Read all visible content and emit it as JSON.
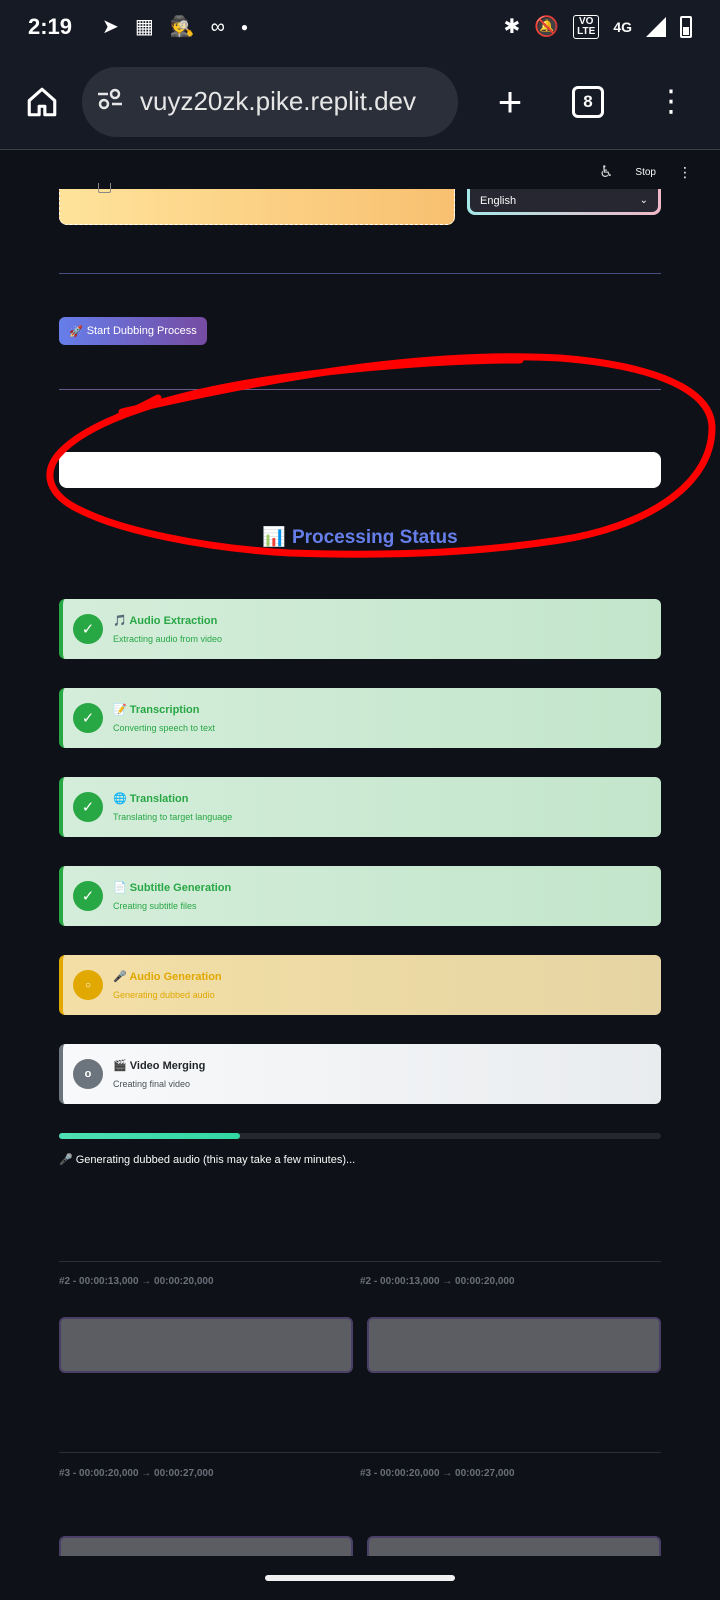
{
  "status_bar": {
    "time": "2:19",
    "network": "4G",
    "volte_line1": "VO",
    "volte_line2": "LTE"
  },
  "browser": {
    "url": "vuyz20zk.pike.replit.dev",
    "tab_count": "8"
  },
  "app_header": {
    "stop_label": "Stop"
  },
  "language_select": {
    "selected": "English"
  },
  "start_button": {
    "icon": "🚀",
    "label": "Start Dubbing Process"
  },
  "processing_status": {
    "icon": "📊",
    "title": "Processing Status",
    "steps": [
      {
        "icon": "🎵",
        "title": "Audio Extraction",
        "subtitle": "Extracting audio from video",
        "state": "done",
        "mark": "✓"
      },
      {
        "icon": "📝",
        "title": "Transcription",
        "subtitle": "Converting speech to text",
        "state": "done",
        "mark": "✓"
      },
      {
        "icon": "🌐",
        "title": "Translation",
        "subtitle": "Translating to target language",
        "state": "done",
        "mark": "✓"
      },
      {
        "icon": "📄",
        "title": "Subtitle Generation",
        "subtitle": "Creating subtitle files",
        "state": "done",
        "mark": "✓"
      },
      {
        "icon": "🎤",
        "title": "Audio Generation",
        "subtitle": "Generating dubbed audio",
        "state": "active",
        "mark": "○"
      },
      {
        "icon": "🎬",
        "title": "Video Merging",
        "subtitle": "Creating final video",
        "state": "pending",
        "mark": "o"
      }
    ]
  },
  "progress": {
    "fraction": 0.3,
    "message": "🎤 Generating dubbed audio (this may take a few minutes)..."
  },
  "segments": [
    {
      "left": "#2 - 00:00:13,000 → 00:00:20,000",
      "right": "#2 - 00:00:13,000 → 00:00:20,000"
    },
    {
      "left": "#3 - 00:00:20,000 → 00:00:27,000",
      "right": "#3 - 00:00:20,000 → 00:00:27,000"
    }
  ],
  "colors": {
    "background": "#0e1117",
    "accent": "#667eea",
    "done_green": "#28a745",
    "active_amber": "#e0a800",
    "progress_fill": "#3dd9a8",
    "annotation_red": "#ff0000"
  }
}
